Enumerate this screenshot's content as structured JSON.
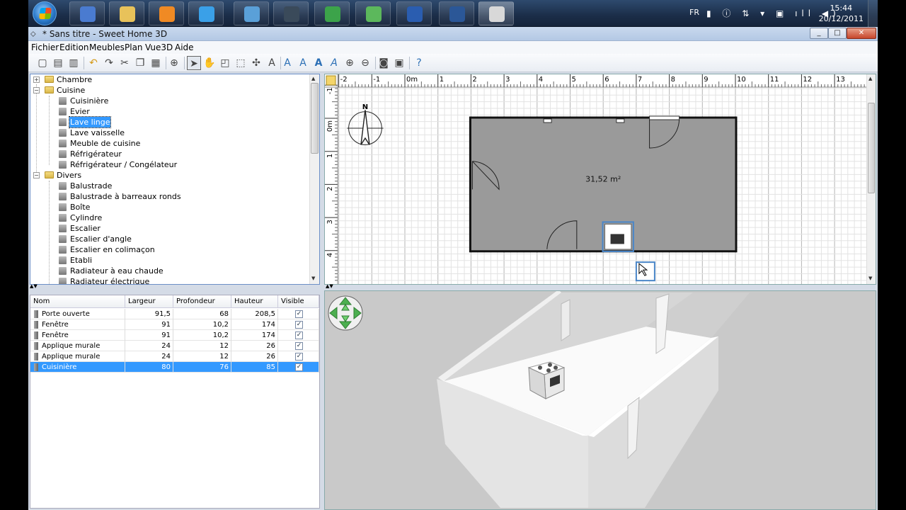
{
  "taskbar": {
    "apps": [
      {
        "name": "paint-icon",
        "color": "#4a7bd0"
      },
      {
        "name": "explorer-icon",
        "color": "#e8c25a"
      },
      {
        "name": "media-player-icon",
        "color": "#f08a24"
      },
      {
        "name": "internet-explorer-icon",
        "color": "#3aa0e8"
      },
      {
        "name": "network-icon",
        "color": "#5aa0d8"
      },
      {
        "name": "webcam-icon",
        "color": "#3a4a5a"
      },
      {
        "name": "chrome-icon",
        "color": "#3ca34a"
      },
      {
        "name": "people-icon",
        "color": "#5cb85c"
      },
      {
        "name": "capture-icon",
        "color": "#2a5db0"
      },
      {
        "name": "word-icon",
        "color": "#2b5797"
      },
      {
        "name": "sweethome3d-icon",
        "color": "#d8d8d8"
      }
    ],
    "lang": "FR",
    "time": "15:44",
    "date": "20/12/2011"
  },
  "window": {
    "title": "* Sans titre - Sweet Home 3D",
    "controls": {
      "minimize": "_",
      "maximize": "□",
      "close": "✕"
    }
  },
  "menu": [
    "Fichier",
    "Edition",
    "Meubles",
    "Plan",
    "Vue3D",
    "Aide"
  ],
  "catalog": {
    "rows": [
      {
        "type": "folder",
        "label": "Chambre",
        "expanded": false
      },
      {
        "type": "folder",
        "label": "Cuisine",
        "expanded": true
      },
      {
        "type": "item",
        "label": "Cuisinière"
      },
      {
        "type": "item",
        "label": "Evier"
      },
      {
        "type": "item",
        "label": "Lave linge",
        "selected": true
      },
      {
        "type": "item",
        "label": "Lave vaisselle"
      },
      {
        "type": "item",
        "label": "Meuble de cuisine"
      },
      {
        "type": "item",
        "label": "Réfrigérateur"
      },
      {
        "type": "item",
        "label": "Réfrigérateur / Congélateur"
      },
      {
        "type": "folder",
        "label": "Divers",
        "expanded": true
      },
      {
        "type": "item",
        "label": "Balustrade"
      },
      {
        "type": "item",
        "label": "Balustrade à barreaux ronds"
      },
      {
        "type": "item",
        "label": "Boîte"
      },
      {
        "type": "item",
        "label": "Cylindre"
      },
      {
        "type": "item",
        "label": "Escalier"
      },
      {
        "type": "item",
        "label": "Escalier d'angle"
      },
      {
        "type": "item",
        "label": "Escalier en colimaçon"
      },
      {
        "type": "item",
        "label": "Etabli"
      },
      {
        "type": "item",
        "label": "Radiateur à eau chaude"
      },
      {
        "type": "item",
        "label": "Radiateur électrique"
      }
    ]
  },
  "furniture": {
    "columns": [
      "Nom",
      "Largeur",
      "Profondeur",
      "Hauteur",
      "Visible"
    ],
    "rows": [
      {
        "name": "Porte ouverte",
        "width": "91,5",
        "depth": "68",
        "height": "208,5",
        "visible": "✓"
      },
      {
        "name": "Fenêtre",
        "width": "91",
        "depth": "10,2",
        "height": "174",
        "visible": "✓"
      },
      {
        "name": "Fenêtre",
        "width": "91",
        "depth": "10,2",
        "height": "174",
        "visible": "✓"
      },
      {
        "name": "Applique murale",
        "width": "24",
        "depth": "12",
        "height": "26",
        "visible": "✓"
      },
      {
        "name": "Applique murale",
        "width": "24",
        "depth": "12",
        "height": "26",
        "visible": "✓"
      },
      {
        "name": "Cuisinière",
        "width": "80",
        "depth": "76",
        "height": "85",
        "visible": "✓",
        "selected": true
      }
    ]
  },
  "plan": {
    "x_ruler": [
      "-2",
      "-1",
      "0m",
      "1",
      "2",
      "3",
      "4",
      "5",
      "6",
      "7",
      "8",
      "9",
      "10",
      "11",
      "12",
      "13"
    ],
    "y_ruler": [
      "-1",
      "0m",
      "1",
      "2",
      "3",
      "4"
    ],
    "compass_label": "N",
    "room_area": "31,52 m²"
  },
  "view3d": {
    "nav": "navigation-arrows"
  }
}
